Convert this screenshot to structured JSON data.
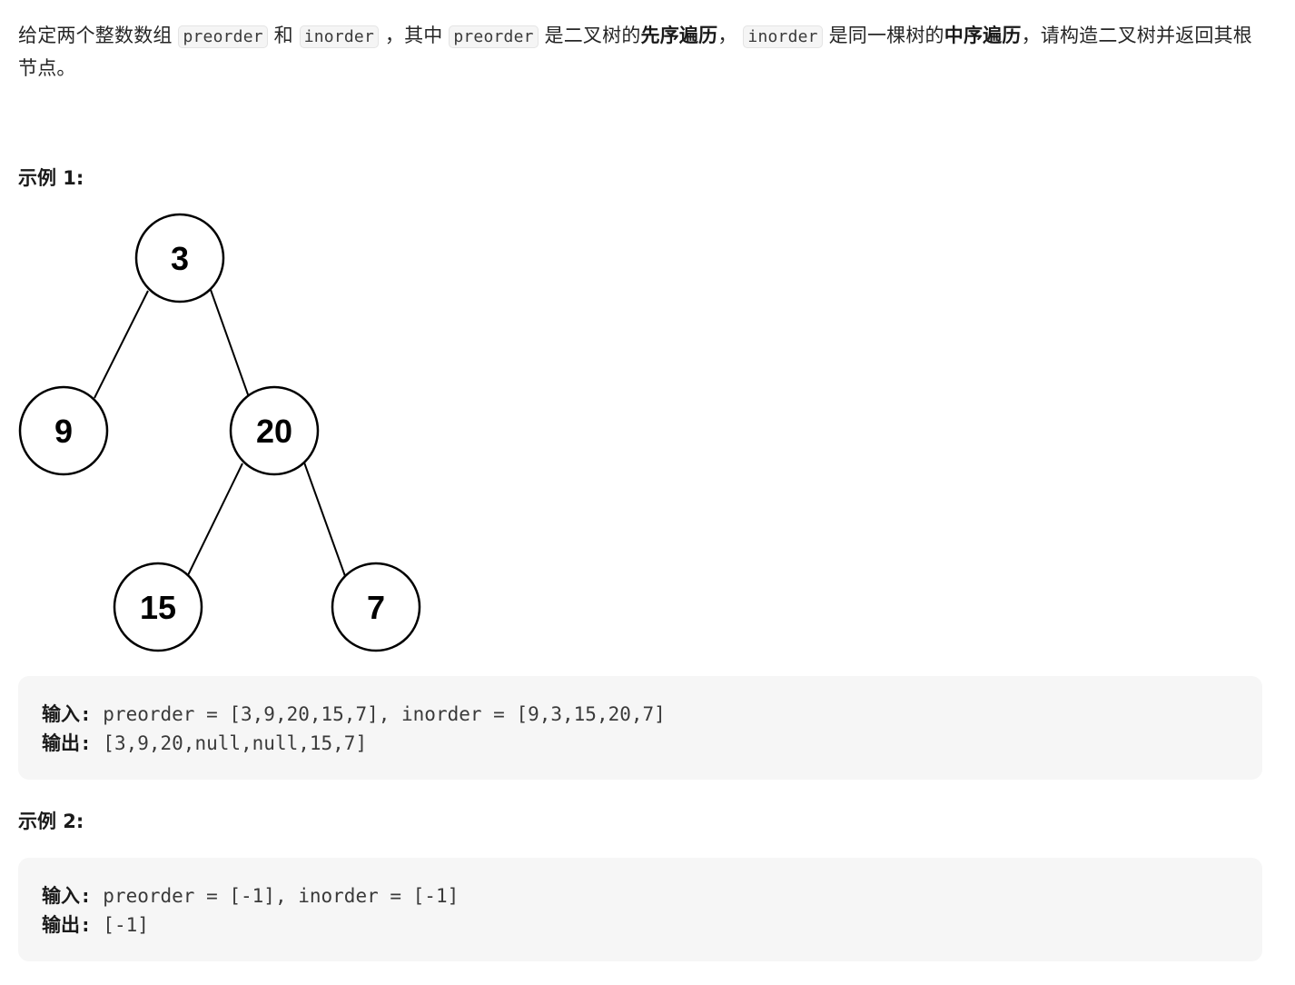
{
  "problem": {
    "part1": "给定两个整数数组 ",
    "code_preorder": "preorder",
    "part2": " 和 ",
    "code_inorder": "inorder",
    "part3": " ，其中 ",
    "part4": " 是二叉树的",
    "bold_preorder": "先序遍历",
    "part5": "， ",
    "part6": " 是同一棵树的",
    "bold_inorder": "中序遍历",
    "part7": "，请构造二叉树并返回其根节点。"
  },
  "examples": [
    {
      "heading": "示例 1:",
      "input_label": "输入:",
      "input_value": " preorder = [3,9,20,15,7], inorder = [9,3,15,20,7]",
      "output_label": "输出:",
      "output_value": " [3,9,20,null,null,15,7]"
    },
    {
      "heading": "示例 2:",
      "input_label": "输入:",
      "input_value": " preorder = [-1], inorder = [-1]",
      "output_label": "输出:",
      "output_value": " [-1]"
    }
  ],
  "tree": {
    "nodes": [
      "3",
      "9",
      "20",
      "15",
      "7"
    ]
  }
}
